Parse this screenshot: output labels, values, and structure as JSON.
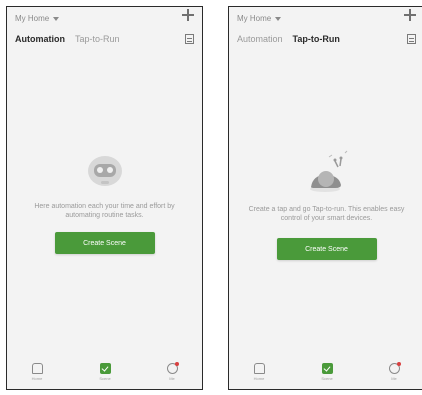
{
  "screens": [
    {
      "home_label": "My Home",
      "tabs": [
        {
          "label": "Automation",
          "active": true
        },
        {
          "label": "Tap-to-Run",
          "active": false
        }
      ],
      "empty_message": "Here automation each your time and effort by automating routine tasks.",
      "button_label": "Create Scene",
      "nav": [
        "Home",
        "Scene",
        "Me"
      ]
    },
    {
      "home_label": "My Home",
      "tabs": [
        {
          "label": "Automation",
          "active": false
        },
        {
          "label": "Tap-to-Run",
          "active": true
        }
      ],
      "empty_message": "Create a tap and go Tap-to-run. This enables easy control of your smart devices.",
      "button_label": "Create Scene",
      "nav": [
        "Home",
        "Scene",
        "Me"
      ]
    }
  ],
  "colors": {
    "accent": "#4a9a3a",
    "badge": "#d94040"
  },
  "icons": [
    "add-icon",
    "chevron-down-icon",
    "log-icon",
    "robot-empty-icon",
    "snail-empty-icon",
    "home-icon",
    "scene-icon",
    "me-icon"
  ]
}
